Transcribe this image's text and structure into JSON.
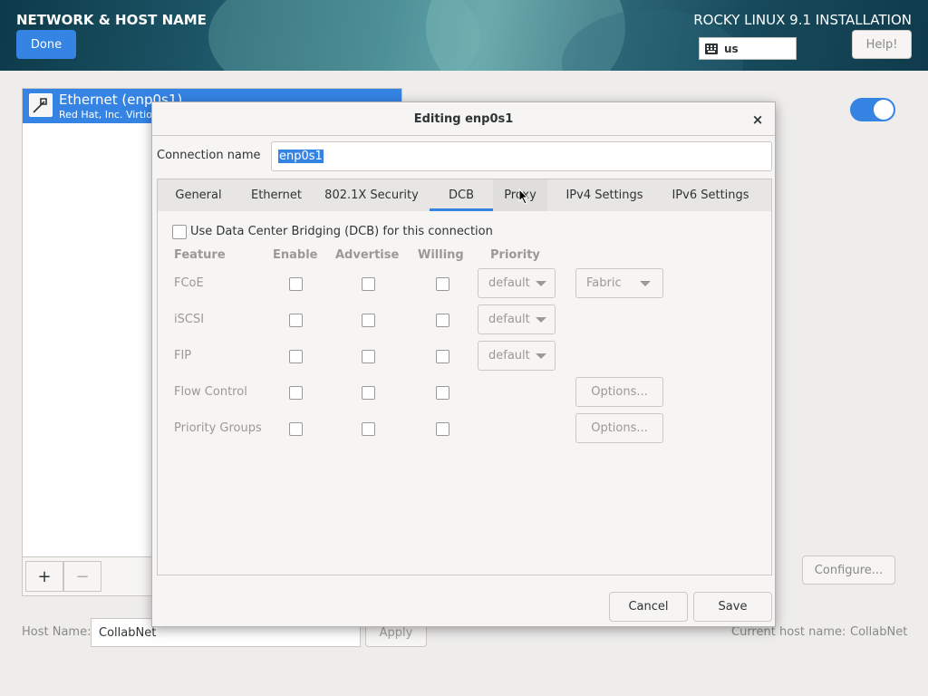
{
  "header": {
    "title": "NETWORK & HOST NAME",
    "done_label": "Done",
    "product": "ROCKY LINUX 9.1 INSTALLATION",
    "keyboard_layout": "us",
    "help_label": "Help!"
  },
  "sidebar": {
    "device_name": "Ethernet (enp0s1)",
    "device_vendor": "Red Hat, Inc. Virtio ne",
    "add_label": "+",
    "remove_label": "−"
  },
  "main": {
    "configure_label": "Configure...",
    "toggle_on": true
  },
  "hostname": {
    "label": "Host Name:",
    "value": "CollabNet",
    "apply_label": "Apply",
    "current_label": "Current host name:",
    "current_value": "CollabNet"
  },
  "dialog": {
    "title": "Editing enp0s1",
    "close_glyph": "×",
    "connection_name_label": "Connection name",
    "connection_name_value": "enp0s1",
    "tabs": [
      {
        "label": "General"
      },
      {
        "label": "Ethernet"
      },
      {
        "label": "802.1X Security"
      },
      {
        "label": "DCB"
      },
      {
        "label": "Proxy"
      },
      {
        "label": "IPv4 Settings"
      },
      {
        "label": "IPv6 Settings"
      }
    ],
    "active_tab": "DCB",
    "dcb": {
      "use_dcb_label": "Use Data Center Bridging (DCB) for this connection",
      "columns": [
        "Feature",
        "Enable",
        "Advertise",
        "Willing",
        "Priority"
      ],
      "rows": [
        {
          "feature": "FCoE",
          "priority": "default",
          "extra": "Fabric"
        },
        {
          "feature": "iSCSI",
          "priority": "default"
        },
        {
          "feature": "FIP",
          "priority": "default"
        },
        {
          "feature": "Flow Control",
          "options": "Options..."
        },
        {
          "feature": "Priority Groups",
          "options": "Options..."
        }
      ]
    },
    "cancel_label": "Cancel",
    "save_label": "Save"
  },
  "colors": {
    "accent": "#3584e4",
    "disabled_text": "#9a9996"
  }
}
